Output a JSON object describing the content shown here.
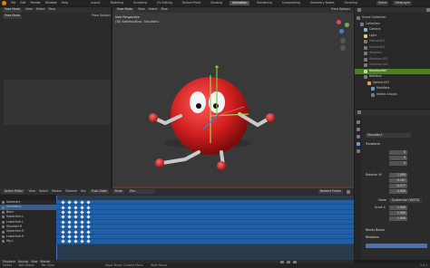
{
  "topbar": {
    "menus": [
      "File",
      "Edit",
      "Render",
      "Window",
      "Help"
    ],
    "workspaces": [
      "Layout",
      "Modeling",
      "Sculpting",
      "UV Editing",
      "Texture Paint",
      "Shading",
      "Animation",
      "Rendering",
      "Compositing",
      "Geometry Nodes",
      "Scripting"
    ],
    "active_workspace": "Animation",
    "scene": "Scene",
    "view_layer": "ViewLayer"
  },
  "viewport": {
    "mode": "Pose Mode",
    "menus": [
      "View",
      "Select",
      "Pose"
    ],
    "overlay_title": "User Perspective",
    "overlay_sub": "(38) Skeleton/Bnd : Shoulder.L",
    "camera_head": "Pose Mode",
    "pose_options": "Pose Options",
    "top_mode": "Pose Mode",
    "top_options": "Pose Options"
  },
  "outliner": {
    "header": "Scene Collection",
    "items": [
      {
        "label": "Scene Collection",
        "selected": false
      },
      {
        "label": "Collection",
        "selected": false
      },
      {
        "label": "Camera",
        "selected": false
      },
      {
        "label": "Light",
        "selected": false
      },
      {
        "label": "Hollow.001",
        "selected": false
      },
      {
        "label": "Hollow.002",
        "selected": false
      },
      {
        "label": "Skeleton",
        "selected": false
      },
      {
        "label": "Skeleton.001",
        "selected": false
      },
      {
        "label": "Skeleton.002",
        "selected": false
      },
      {
        "label": "SkeletonRef",
        "selected": true
      },
      {
        "label": "RefHand",
        "selected": false
      },
      {
        "label": "Sphere.007",
        "selected": false
      },
      {
        "label": "Modifiers",
        "selected": false
      },
      {
        "label": "Vertex Groups",
        "selected": false
      }
    ]
  },
  "properties": {
    "bone": "Shoulder.L",
    "section": "Transform",
    "location": [
      "0",
      "0",
      "0"
    ],
    "rotation_label": "Rotation W",
    "rotation": [
      "1.000",
      "-0.167",
      "-0.077",
      "0.000"
    ],
    "mode_label": "Mode",
    "mode_value": "Quaternion (WXYZ)",
    "scale_label": "Scale X",
    "scale": [
      "1.000",
      "1.000",
      "1.000"
    ],
    "section2": "Bendy Bones",
    "section3": "Relations"
  },
  "dopesheet": {
    "mode": "Action Editor",
    "menus": [
      "View",
      "Select",
      "Marker",
      "Channel",
      "Key"
    ],
    "push_down": "Push Down",
    "stash": "Stash",
    "action": "Run",
    "interp": "Nearest Frame",
    "channels": [
      "Summary",
      "Shoulder.L",
      "Bone",
      "UpperArm.L",
      "LowerArm.L",
      "Shoulder.R",
      "UpperArm.R",
      "LowerArm.R",
      "Hip.L"
    ]
  },
  "timeline": {
    "items": [
      "Playback",
      "Keying",
      "View",
      "Marker"
    ]
  },
  "statusbar": {
    "items": [
      "Select",
      "Box Select",
      "Pan View",
      "Dope Sheet Context Menu",
      "Walk Pause",
      "3.4.1"
    ]
  },
  "colors": {
    "accent": "#4772b3",
    "selected_row": "#4d7f1e",
    "track": "#1f5fa8",
    "ball": "#d32a2a"
  }
}
